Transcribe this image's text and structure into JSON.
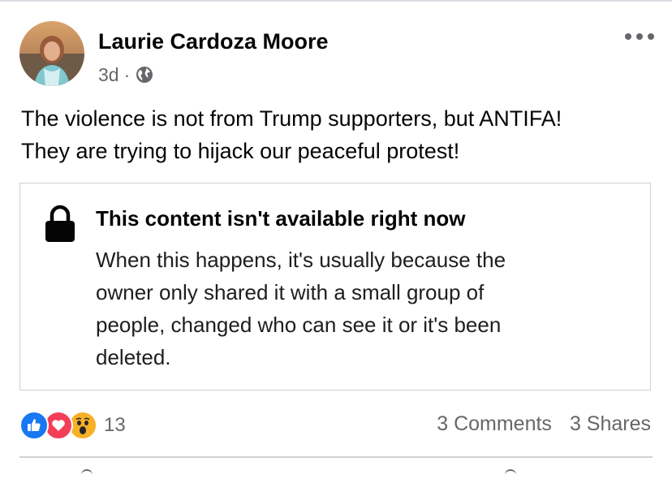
{
  "post": {
    "author": "Laurie Cardoza Moore",
    "time": "3d",
    "separator": "·",
    "privacy_icon": "globe-icon",
    "text_lines": [
      "The violence is not from Trump supporters, but ANTIFA!",
      "They are trying to hijack our peaceful protest!"
    ]
  },
  "attachment": {
    "icon": "lock-icon",
    "title": "This content isn't available right now",
    "body_lines": [
      "When this happens, it's usually because the",
      "owner only shared it with a small group of",
      "people, changed who can see it or it's been",
      "deleted."
    ]
  },
  "engagement": {
    "reaction_icons": [
      "like-icon",
      "love-icon",
      "wow-icon"
    ],
    "reaction_count": "13",
    "comments": "3 Comments",
    "shares": "3 Shares"
  },
  "colors": {
    "like": "#1877f2",
    "love": "#f33e58",
    "wow": "#f7b125",
    "secondary_text": "#65676b",
    "border": "#ced0d4"
  }
}
